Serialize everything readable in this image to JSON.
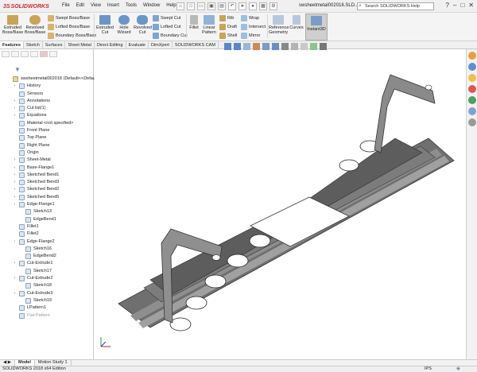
{
  "app": {
    "logo_text": "SOLIDWORKS",
    "doc_title": "swsheetmetal002018.SLD...",
    "search_placeholder": "Search SOLIDWORKS Help",
    "menu": [
      "File",
      "Edit",
      "View",
      "Insert",
      "Tools",
      "Window",
      "Help"
    ]
  },
  "ribbon": {
    "extruded_boss": "Extruded Boss/Base",
    "revolved_boss": "Revolved Boss/Base",
    "swept_boss": "Swept Boss/Base",
    "lofted_boss": "Lofted Boss/Base",
    "boundary_boss": "Boundary Boss/Base",
    "extruded_cut": "Extruded Cut",
    "hole_wizard": "Hole Wizard",
    "revolved_cut": "Revolved Cut",
    "swept_cut": "Swept Cut",
    "lofted_cut": "Lofted Cut",
    "boundary_cut": "Boundary Cut",
    "fillet": "Fillet",
    "linear_pattern": "Linear Pattern",
    "rib": "Rib",
    "draft": "Draft",
    "shell": "Shell",
    "wrap": "Wrap",
    "intersect": "Intersect",
    "mirror": "Mirror",
    "reference_geometry": "Reference Geometry",
    "curves": "Curves",
    "instant3d": "Instant3D"
  },
  "tabs": [
    "Features",
    "Sketch",
    "Surfaces",
    "Sheet Metal",
    "Direct Editing",
    "Evaluate",
    "DimXpert",
    "SOLIDWORKS CAM"
  ],
  "tree": {
    "root": "swsheetmetal002018  (Default<<Default",
    "items": [
      {
        "label": "History",
        "arrow": true,
        "indent": 0
      },
      {
        "label": "Sensors",
        "arrow": false,
        "indent": 0
      },
      {
        "label": "Annotations",
        "arrow": true,
        "indent": 0
      },
      {
        "label": "Cut list(1)",
        "arrow": true,
        "indent": 0
      },
      {
        "label": "Equations",
        "arrow": true,
        "indent": 0
      },
      {
        "label": "Material <not specified>",
        "arrow": false,
        "indent": 0
      },
      {
        "label": "Front Plane",
        "arrow": false,
        "indent": 0
      },
      {
        "label": "Top Plane",
        "arrow": false,
        "indent": 0
      },
      {
        "label": "Right Plane",
        "arrow": false,
        "indent": 0
      },
      {
        "label": "Origin",
        "arrow": false,
        "indent": 0
      },
      {
        "label": "Sheet-Metal",
        "arrow": true,
        "indent": 0
      },
      {
        "label": "Base-Flange1",
        "arrow": true,
        "indent": 0
      },
      {
        "label": "Sketched Bend1",
        "arrow": true,
        "indent": 0
      },
      {
        "label": "Sketched Bend3",
        "arrow": true,
        "indent": 0
      },
      {
        "label": "Sketched Bend2",
        "arrow": true,
        "indent": 0
      },
      {
        "label": "Sketched Bend5",
        "arrow": true,
        "indent": 0
      },
      {
        "label": "Edge-Flange1",
        "arrow": true,
        "indent": 0
      },
      {
        "label": "Sketch13",
        "arrow": false,
        "indent": 1
      },
      {
        "label": "EdgeBend1",
        "arrow": false,
        "indent": 1
      },
      {
        "label": "Fillet1",
        "arrow": false,
        "indent": 0
      },
      {
        "label": "Fillet2",
        "arrow": false,
        "indent": 0
      },
      {
        "label": "Edge-Flange2",
        "arrow": true,
        "indent": 0
      },
      {
        "label": "Sketch16",
        "arrow": false,
        "indent": 1
      },
      {
        "label": "EdgeBend2",
        "arrow": false,
        "indent": 1
      },
      {
        "label": "Cut-Extrude1",
        "arrow": true,
        "indent": 0
      },
      {
        "label": "Sketch17",
        "arrow": false,
        "indent": 1
      },
      {
        "label": "Cut-Extrude2",
        "arrow": true,
        "indent": 0
      },
      {
        "label": "Sketch18",
        "arrow": false,
        "indent": 1
      },
      {
        "label": "Cut-Extrude3",
        "arrow": true,
        "indent": 0
      },
      {
        "label": "Sketch19",
        "arrow": false,
        "indent": 1
      },
      {
        "label": "LPattern1",
        "arrow": false,
        "indent": 0
      },
      {
        "label": "Flat-Pattern",
        "arrow": false,
        "indent": 0,
        "dim": true
      }
    ]
  },
  "bottom_tabs": [
    "Model",
    "Motion Study 1"
  ],
  "status": {
    "edition": "SOLIDWORKS 2018 x64 Edition",
    "units": "IPS"
  }
}
